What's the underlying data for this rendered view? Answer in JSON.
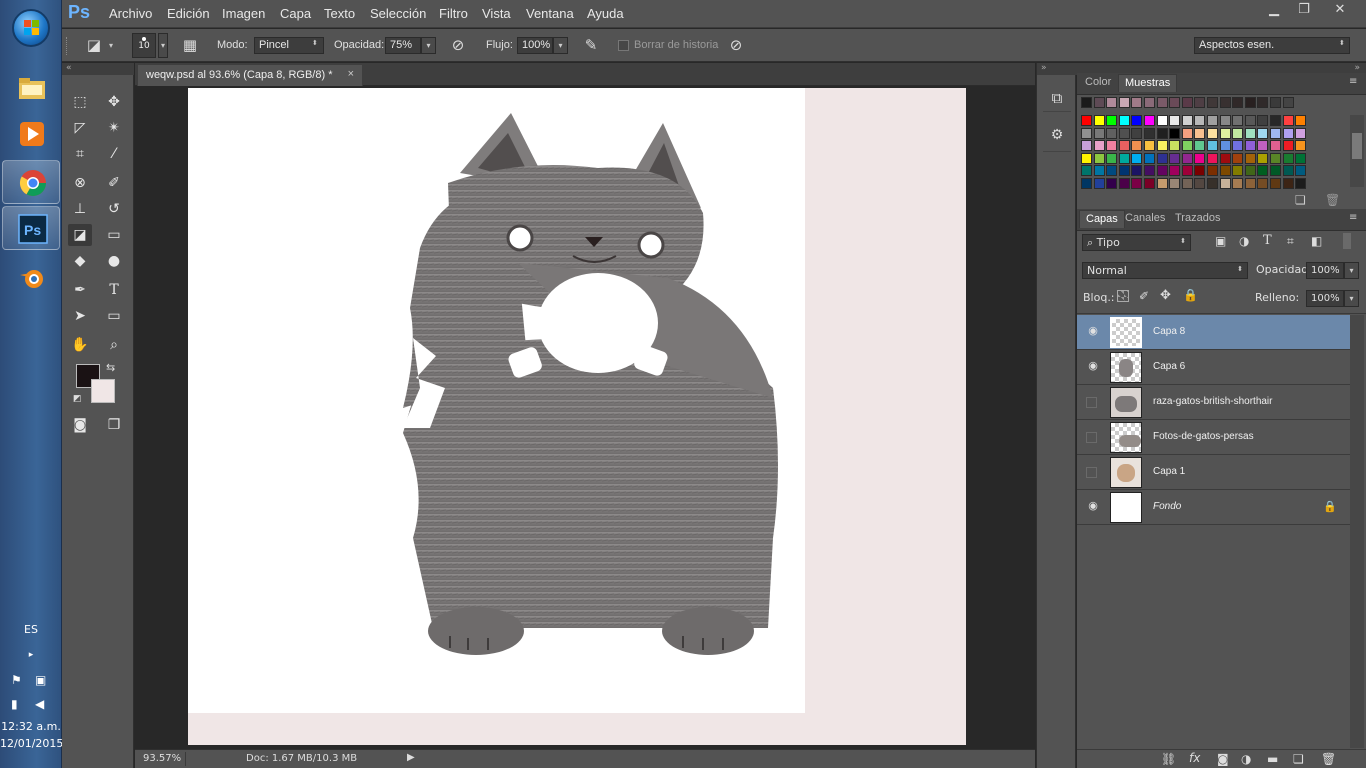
{
  "taskbar": {
    "lang": "ES",
    "time": "12:32 a.m.",
    "date": "12/01/2015"
  },
  "menubar": {
    "logo": "Ps",
    "items": [
      "Archivo",
      "Edición",
      "Imagen",
      "Capa",
      "Texto",
      "Selección",
      "Filtro",
      "Vista",
      "Ventana",
      "Ayuda"
    ]
  },
  "options": {
    "brush_size": "10",
    "mode_label": "Modo:",
    "mode_value": "Pincel",
    "opacity_label": "Opacidad:",
    "opacity_value": "75%",
    "flow_label": "Flujo:",
    "flow_value": "100%",
    "erase_history": "Borrar de historia",
    "workspace": "Aspectos esen."
  },
  "document": {
    "tab_title": "weqw.psd al 93.6% (Capa 8, RGB/8) *",
    "zoom": "93.57%",
    "doc_info": "Doc: 1.67 MB/10.3 MB"
  },
  "swatches_panel": {
    "tabs": [
      "Color",
      "Muestras"
    ],
    "active_tab": "Muestras"
  },
  "layers_panel": {
    "tabs": [
      "Capas",
      "Canales",
      "Trazados"
    ],
    "active_tab": "Capas",
    "filter_value": "Tipo",
    "blend_mode": "Normal",
    "opacity_label": "Opacidad:",
    "opacity_value": "100%",
    "lock_label": "Bloq.:",
    "fill_label": "Relleno:",
    "fill_value": "100%",
    "layers": [
      {
        "name": "Capa 8",
        "visible": true,
        "selected": true
      },
      {
        "name": "Capa 6",
        "visible": true,
        "selected": false
      },
      {
        "name": "raza-gatos-british-shorthair",
        "visible": false,
        "selected": false
      },
      {
        "name": "Fotos-de-gatos-persas",
        "visible": false,
        "selected": false
      },
      {
        "name": "Capa 1",
        "visible": false,
        "selected": false
      },
      {
        "name": "Fondo",
        "visible": true,
        "selected": false,
        "locked": true
      }
    ]
  },
  "colors": {
    "foreground": "#1a1214",
    "background": "#f0e6e6",
    "selection": "#6b88aa",
    "ps_blue": "#6db5ff"
  }
}
